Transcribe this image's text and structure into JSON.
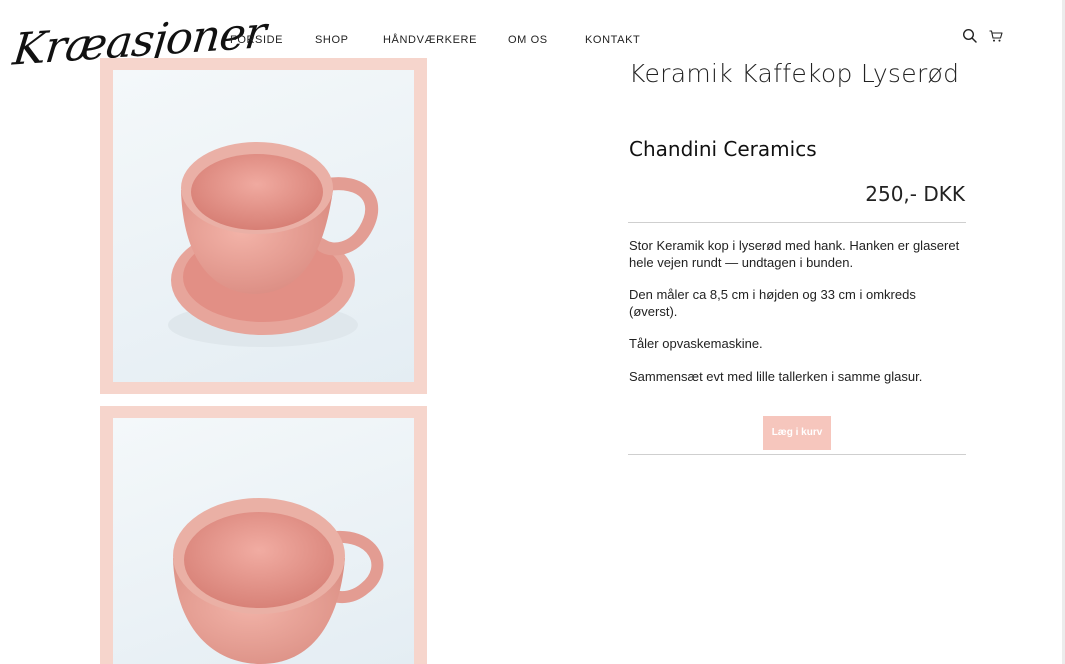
{
  "header": {
    "logo_text": "Kræasjoner",
    "nav": [
      "FORSIDE",
      "SHOP",
      "HÅNDVÆRKERE",
      "OM OS",
      "KONTAKT"
    ],
    "icons": [
      "search-icon",
      "cart-icon"
    ]
  },
  "product": {
    "title": "Keramik Kaffekop Lyserød",
    "brand": "Chandini Ceramics",
    "price": "250,- DKK",
    "description": [
      "Stor Keramik kop i lyserød med hank. Hanken er glaseret hele vejen rundt — undtagen i bunden.",
      "Den måler ca 8,5 cm i højden og 33 cm i omkreds (øverst).",
      "Tåler opvaskemaskine.",
      "Sammensæt evt med lille tallerken i samme glasur."
    ],
    "add_to_cart_label": "Læg i kurv"
  },
  "colors": {
    "frame": "#f6d5cc",
    "button": "#f6c6bd",
    "cup": "#e99a90"
  }
}
